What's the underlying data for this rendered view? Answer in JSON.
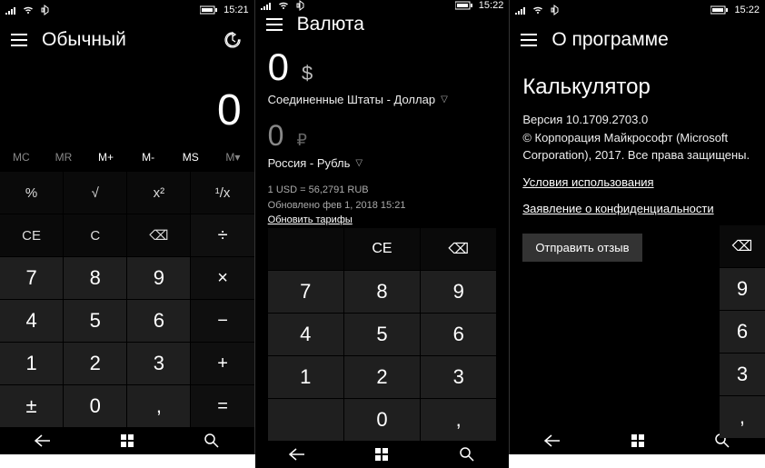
{
  "status": {
    "time1": "15:21",
    "time2": "15:22",
    "time3": "15:22"
  },
  "s1": {
    "title": "Обычный",
    "display": "0",
    "mem": [
      "MC",
      "MR",
      "M+",
      "M-",
      "MS",
      "M▾"
    ],
    "grid": [
      [
        "%",
        "fn"
      ],
      [
        "√",
        "fn"
      ],
      [
        "x²",
        "fn"
      ],
      [
        "¹/x",
        "fn"
      ],
      [
        "CE",
        "fn"
      ],
      [
        "C",
        "fn"
      ],
      [
        "⌫",
        "fn"
      ],
      [
        "÷",
        "op"
      ],
      [
        "7",
        "num"
      ],
      [
        "8",
        "num"
      ],
      [
        "9",
        "num"
      ],
      [
        "×",
        "op"
      ],
      [
        "4",
        "num"
      ],
      [
        "5",
        "num"
      ],
      [
        "6",
        "num"
      ],
      [
        "−",
        "op"
      ],
      [
        "1",
        "num"
      ],
      [
        "2",
        "num"
      ],
      [
        "3",
        "num"
      ],
      [
        "+",
        "op"
      ],
      [
        "±",
        "num"
      ],
      [
        "0",
        "num"
      ],
      [
        ",",
        "num"
      ],
      [
        "=",
        "op"
      ]
    ]
  },
  "s2": {
    "title": "Валюта",
    "from_val": "0",
    "from_sym": "$",
    "from_label": "Соединенные Штаты - Доллар",
    "to_val": "0",
    "to_sym": "₽",
    "to_label": "Россия - Рубль",
    "rate": "1 USD = 56,2791 RUB",
    "updated": "Обновлено фев 1, 2018 15:21",
    "refresh": "Обновить тарифы",
    "grid": [
      [
        "",
        "fn"
      ],
      [
        "CE",
        "fn"
      ],
      [
        "⌫",
        "fn"
      ],
      [
        "7",
        "num"
      ],
      [
        "8",
        "num"
      ],
      [
        "9",
        "num"
      ],
      [
        "4",
        "num"
      ],
      [
        "5",
        "num"
      ],
      [
        "6",
        "num"
      ],
      [
        "1",
        "num"
      ],
      [
        "2",
        "num"
      ],
      [
        "3",
        "num"
      ],
      [
        "",
        "num"
      ],
      [
        "0",
        "num"
      ],
      [
        ",",
        "num"
      ]
    ]
  },
  "s3": {
    "title": "О программе",
    "app": "Калькулятор",
    "version": "Версия 10.1709.2703.0",
    "copyright": "© Корпорация Майкрософт (Microsoft Corporation), 2017. Все права защищены.",
    "terms": "Условия использования",
    "privacy": "Заявление о конфиденциальности",
    "feedback": "Отправить отзыв",
    "side": [
      "⌫",
      "9",
      "6",
      "3",
      ","
    ]
  }
}
